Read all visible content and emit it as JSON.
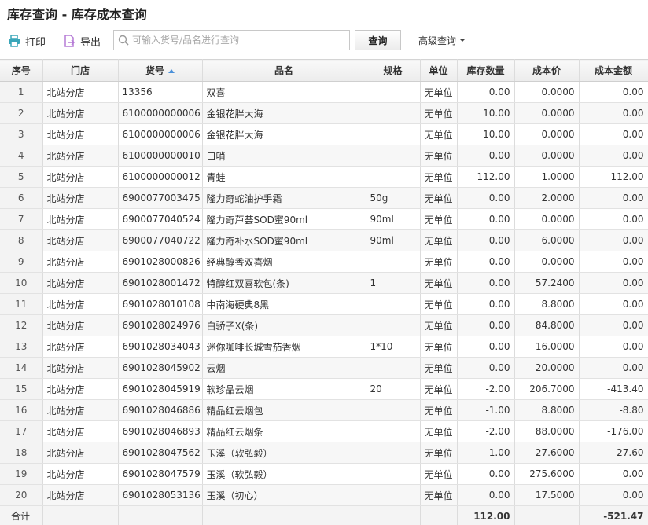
{
  "page": {
    "title": "库存查询 - 库存成本查询"
  },
  "toolbar": {
    "print_label": "打印",
    "export_label": "导出",
    "search_placeholder": "可输入货号/品名进行查询",
    "query_label": "查询",
    "advanced_label": "高级查询"
  },
  "colors": {
    "print_icon": "#3aa6b9",
    "export_icon": "#b57bd6",
    "sort_arrow": "#4a90d9"
  },
  "table": {
    "headers": [
      "序号",
      "门店",
      "货号",
      "品名",
      "规格",
      "单位",
      "库存数量",
      "成本价",
      "成本金额"
    ],
    "sorted_column": "货号",
    "rows": [
      [
        "1",
        "北站分店",
        "13356",
        "双喜",
        "",
        "无单位",
        "0.00",
        "0.0000",
        "0.00"
      ],
      [
        "2",
        "北站分店",
        "6100000000006",
        "金银花胖大海",
        "",
        "无单位",
        "10.00",
        "0.0000",
        "0.00"
      ],
      [
        "3",
        "北站分店",
        "6100000000006",
        "金银花胖大海",
        "",
        "无单位",
        "10.00",
        "0.0000",
        "0.00"
      ],
      [
        "4",
        "北站分店",
        "6100000000010",
        "口哨",
        "",
        "无单位",
        "0.00",
        "0.0000",
        "0.00"
      ],
      [
        "5",
        "北站分店",
        "6100000000012",
        "青蛙",
        "",
        "无单位",
        "112.00",
        "1.0000",
        "112.00"
      ],
      [
        "6",
        "北站分店",
        "6900077003475",
        "隆力奇蛇油护手霜",
        "50g",
        "无单位",
        "0.00",
        "2.0000",
        "0.00"
      ],
      [
        "7",
        "北站分店",
        "6900077040524",
        "隆力奇芦荟SOD蜜90ml",
        "90ml",
        "无单位",
        "0.00",
        "0.0000",
        "0.00"
      ],
      [
        "8",
        "北站分店",
        "6900077040722",
        "隆力奇补水SOD蜜90ml",
        "90ml",
        "无单位",
        "0.00",
        "6.0000",
        "0.00"
      ],
      [
        "9",
        "北站分店",
        "6901028000826",
        "经典醇香双喜烟",
        "",
        "无单位",
        "0.00",
        "0.0000",
        "0.00"
      ],
      [
        "10",
        "北站分店",
        "6901028001472",
        "特醇红双喜软包(条)",
        "1",
        "无单位",
        "0.00",
        "57.2400",
        "0.00"
      ],
      [
        "11",
        "北站分店",
        "6901028010108",
        "中南海硬典8黑",
        "",
        "无单位",
        "0.00",
        "8.8000",
        "0.00"
      ],
      [
        "12",
        "北站分店",
        "6901028024976",
        "白骄子X(条)",
        "",
        "无单位",
        "0.00",
        "84.8000",
        "0.00"
      ],
      [
        "13",
        "北站分店",
        "6901028034043",
        "迷你咖啡长城雪茄香烟",
        "1*10",
        "无单位",
        "0.00",
        "16.0000",
        "0.00"
      ],
      [
        "14",
        "北站分店",
        "6901028045902",
        "云烟",
        "",
        "无单位",
        "0.00",
        "20.0000",
        "0.00"
      ],
      [
        "15",
        "北站分店",
        "6901028045919",
        "软珍品云烟",
        "20",
        "无单位",
        "-2.00",
        "206.7000",
        "-413.40"
      ],
      [
        "16",
        "北站分店",
        "6901028046886",
        "精品红云烟包",
        "",
        "无单位",
        "-1.00",
        "8.8000",
        "-8.80"
      ],
      [
        "17",
        "北站分店",
        "6901028046893",
        "精品红云烟条",
        "",
        "无单位",
        "-2.00",
        "88.0000",
        "-176.00"
      ],
      [
        "18",
        "北站分店",
        "6901028047562",
        "玉溪（软弘毅）",
        "",
        "无单位",
        "-1.00",
        "27.6000",
        "-27.60"
      ],
      [
        "19",
        "北站分店",
        "6901028047579",
        "玉溪（软弘毅）",
        "",
        "无单位",
        "0.00",
        "275.6000",
        "0.00"
      ],
      [
        "20",
        "北站分店",
        "6901028053136",
        "玉溪（初心）",
        "",
        "无单位",
        "0.00",
        "17.5000",
        "0.00"
      ]
    ],
    "footer": {
      "label": "合计",
      "total_qty": "112.00",
      "total_amount": "-521.47"
    }
  }
}
